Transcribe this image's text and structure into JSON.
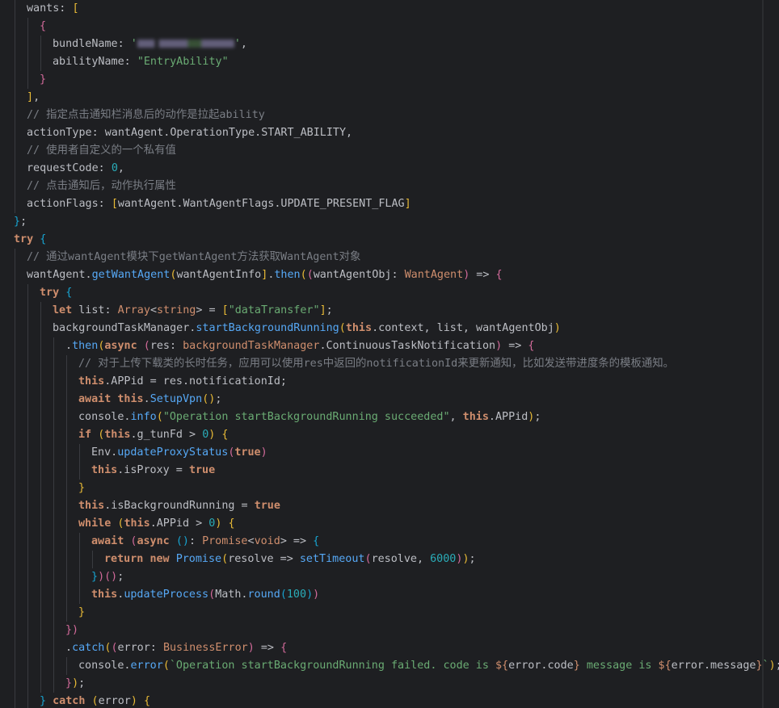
{
  "editor": {
    "language": "ArkTS",
    "colors": {
      "background": "#1e1f22",
      "keyword": "#cf8e6d",
      "string": "#6aab73",
      "number": "#2aacb8",
      "comment": "#7a7e85",
      "function": "#56a8f5",
      "property": "#c77dbb",
      "text": "#bcbec4"
    },
    "redacted_value_note": "",
    "lines": [
      [
        [
          "t-plain",
          "wants: "
        ],
        [
          "t-br",
          "["
        ]
      ],
      [
        [
          "t-br2",
          "{"
        ]
      ],
      [
        [
          "t-plain",
          "bundleName: "
        ],
        [
          "t-str",
          "'"
        ],
        [
          "redacted",
          ""
        ],
        [
          "t-str",
          "'"
        ],
        [
          "t-plain",
          ","
        ]
      ],
      [
        [
          "t-plain",
          "abilityName: "
        ],
        [
          "t-str",
          "\"EntryAbility\""
        ]
      ],
      [
        [
          "t-br2",
          "}"
        ]
      ],
      [
        [
          "t-br",
          "]"
        ],
        [
          "t-plain",
          ","
        ]
      ],
      [
        [
          "t-cm",
          "// 指定点击通知栏消息后的动作是拉起ability"
        ]
      ],
      [
        [
          "t-plain",
          "actionType: wantAgent.OperationType.START_ABILITY,"
        ]
      ],
      [
        [
          "t-cm",
          "// 使用者自定义的一个私有值"
        ]
      ],
      [
        [
          "t-plain",
          "requestCode: "
        ],
        [
          "t-num",
          "0"
        ],
        [
          "t-plain",
          ","
        ]
      ],
      [
        [
          "t-cm",
          "// 点击通知后，动作执行属性"
        ]
      ],
      [
        [
          "t-plain",
          "actionFlags: "
        ],
        [
          "t-br",
          "["
        ],
        [
          "t-plain",
          "wantAgent.WantAgentFlags.UPDATE_PRESENT_FLAG"
        ],
        [
          "t-br",
          "]"
        ]
      ],
      [
        [
          "t-br3",
          "}"
        ],
        [
          "t-plain",
          ";"
        ]
      ],
      [
        [
          "t-kw",
          "try "
        ],
        [
          "t-br3",
          "{"
        ]
      ],
      [
        [
          "t-cm",
          "// 通过wantAgent模块下getWantAgent方法获取WantAgent对象"
        ]
      ],
      [
        [
          "t-plain",
          "wantAgent."
        ],
        [
          "t-fn",
          "getWantAgent"
        ],
        [
          "t-br",
          "("
        ],
        [
          "t-plain",
          "wantAgentInfo"
        ],
        [
          "t-br",
          "]"
        ],
        [
          "t-plain",
          "."
        ],
        [
          "t-fn",
          "then"
        ],
        [
          "t-br",
          "("
        ],
        [
          "t-br2",
          "("
        ],
        [
          "t-plain",
          "wantAgentObj: "
        ],
        [
          "t-type",
          "WantAgent"
        ],
        [
          "t-br2",
          ")"
        ],
        [
          "t-plain",
          " => "
        ],
        [
          "t-br2",
          "{"
        ]
      ],
      [
        [
          "t-kw",
          "try "
        ],
        [
          "t-br3",
          "{"
        ]
      ],
      [
        [
          "t-kw",
          "let "
        ],
        [
          "t-plain",
          "list: "
        ],
        [
          "t-type",
          "Array"
        ],
        [
          "t-plain",
          "<"
        ],
        [
          "t-type",
          "string"
        ],
        [
          "t-plain",
          "> = "
        ],
        [
          "t-br",
          "["
        ],
        [
          "t-str",
          "\"dataTransfer\""
        ],
        [
          "t-br",
          "]"
        ],
        [
          "t-plain",
          ";"
        ]
      ],
      [
        [
          "t-plain",
          "backgroundTaskManager."
        ],
        [
          "t-fn",
          "startBackgroundRunning"
        ],
        [
          "t-br",
          "("
        ],
        [
          "t-kw",
          "this"
        ],
        [
          "t-plain",
          ".context, list, wantAgentObj"
        ],
        [
          "t-br",
          ")"
        ]
      ],
      [
        [
          "t-plain",
          "."
        ],
        [
          "t-fn",
          "then"
        ],
        [
          "t-br",
          "("
        ],
        [
          "t-kw",
          "async "
        ],
        [
          "t-br2",
          "("
        ],
        [
          "t-plain",
          "res: "
        ],
        [
          "t-type",
          "backgroundTaskManager"
        ],
        [
          "t-plain",
          ".ContinuousTaskNotification"
        ],
        [
          "t-br2",
          ")"
        ],
        [
          "t-plain",
          " => "
        ],
        [
          "t-br2",
          "{"
        ]
      ],
      [
        [
          "t-cm",
          "// 对于上传下载类的长时任务，应用可以使用res中返回的notificationId来更新通知，比如发送带进度条的模板通知。"
        ]
      ],
      [
        [
          "t-kw",
          "this"
        ],
        [
          "t-plain",
          ".APPid = res.notificationId;"
        ]
      ],
      [
        [
          "t-kw",
          "await "
        ],
        [
          "t-kw",
          "this"
        ],
        [
          "t-plain",
          "."
        ],
        [
          "t-fn",
          "SetupVpn"
        ],
        [
          "t-br",
          "()"
        ],
        [
          "t-plain",
          ";"
        ]
      ],
      [
        [
          "t-plain",
          "console."
        ],
        [
          "t-fn",
          "info"
        ],
        [
          "t-br",
          "("
        ],
        [
          "t-str",
          "\"Operation startBackgroundRunning succeeded\""
        ],
        [
          "t-plain",
          ", "
        ],
        [
          "t-kw",
          "this"
        ],
        [
          "t-plain",
          ".APPid"
        ],
        [
          "t-br",
          ")"
        ],
        [
          "t-plain",
          ";"
        ]
      ],
      [
        [
          "t-kw",
          "if "
        ],
        [
          "t-br",
          "("
        ],
        [
          "t-kw",
          "this"
        ],
        [
          "t-plain",
          ".g_tunFd > "
        ],
        [
          "t-num",
          "0"
        ],
        [
          "t-br",
          ")"
        ],
        [
          "t-plain",
          " "
        ],
        [
          "t-br",
          "{"
        ]
      ],
      [
        [
          "t-plain",
          "Env."
        ],
        [
          "t-fn",
          "updateProxyStatus"
        ],
        [
          "t-br2",
          "("
        ],
        [
          "t-kw",
          "true"
        ],
        [
          "t-br2",
          ")"
        ]
      ],
      [
        [
          "t-kw",
          "this"
        ],
        [
          "t-plain",
          ".isProxy = "
        ],
        [
          "t-kw",
          "true"
        ]
      ],
      [
        [
          "t-br",
          "}"
        ]
      ],
      [
        [
          "t-kw",
          "this"
        ],
        [
          "t-plain",
          ".isBackgroundRunning = "
        ],
        [
          "t-kw",
          "true"
        ]
      ],
      [
        [
          "t-kw",
          "while "
        ],
        [
          "t-br",
          "("
        ],
        [
          "t-kw",
          "this"
        ],
        [
          "t-plain",
          ".APPid > "
        ],
        [
          "t-num",
          "0"
        ],
        [
          "t-br",
          ")"
        ],
        [
          "t-plain",
          " "
        ],
        [
          "t-br",
          "{"
        ]
      ],
      [
        [
          "t-kw",
          "await "
        ],
        [
          "t-br2",
          "("
        ],
        [
          "t-kw",
          "async "
        ],
        [
          "t-br3",
          "()"
        ],
        [
          "t-plain",
          ": "
        ],
        [
          "t-type",
          "Promise"
        ],
        [
          "t-plain",
          "<"
        ],
        [
          "t-type",
          "void"
        ],
        [
          "t-plain",
          "> => "
        ],
        [
          "t-br3",
          "{"
        ]
      ],
      [
        [
          "t-kw",
          "return "
        ],
        [
          "t-kw",
          "new "
        ],
        [
          "t-fn",
          "Promise"
        ],
        [
          "t-br",
          "("
        ],
        [
          "t-plain",
          "resolve => "
        ],
        [
          "t-fn",
          "setTimeout"
        ],
        [
          "t-br2",
          "("
        ],
        [
          "t-plain",
          "resolve, "
        ],
        [
          "t-num",
          "6000"
        ],
        [
          "t-br2",
          ")"
        ],
        [
          "t-br",
          ")"
        ],
        [
          "t-plain",
          ";"
        ]
      ],
      [
        [
          "t-br3",
          "}"
        ],
        [
          "t-br2",
          ")"
        ],
        [
          "t-br2",
          "()"
        ],
        [
          "t-plain",
          ";"
        ]
      ],
      [
        [
          "t-kw",
          "this"
        ],
        [
          "t-plain",
          "."
        ],
        [
          "t-fn",
          "updateProcess"
        ],
        [
          "t-br2",
          "("
        ],
        [
          "t-plain",
          "Math."
        ],
        [
          "t-fn",
          "round"
        ],
        [
          "t-br3",
          "("
        ],
        [
          "t-num",
          "100"
        ],
        [
          "t-br3",
          ")"
        ],
        [
          "t-br2",
          ")"
        ]
      ],
      [
        [
          "t-br",
          "}"
        ]
      ],
      [
        [
          "t-br2",
          "})"
        ]
      ],
      [
        [
          "t-plain",
          "."
        ],
        [
          "t-fn",
          "catch"
        ],
        [
          "t-br",
          "("
        ],
        [
          "t-br2",
          "("
        ],
        [
          "t-plain",
          "error: "
        ],
        [
          "t-type",
          "BusinessError"
        ],
        [
          "t-br2",
          ")"
        ],
        [
          "t-plain",
          " => "
        ],
        [
          "t-br2",
          "{"
        ]
      ],
      [
        [
          "t-plain",
          "console."
        ],
        [
          "t-fn",
          "error"
        ],
        [
          "t-br",
          "("
        ],
        [
          "t-str",
          "`Operation startBackgroundRunning failed. code is "
        ],
        [
          "t-tpld",
          "${"
        ],
        [
          "t-tplv",
          "error.code"
        ],
        [
          "t-tpld",
          "}"
        ],
        [
          "t-str",
          " message is "
        ],
        [
          "t-tpld",
          "${"
        ],
        [
          "t-tplv",
          "error.message"
        ],
        [
          "t-tpld",
          "}"
        ],
        [
          "t-str",
          "`"
        ],
        [
          "t-br",
          ")"
        ],
        [
          "t-plain",
          ";"
        ]
      ],
      [
        [
          "t-br2",
          "}"
        ],
        [
          "t-br",
          ")"
        ],
        [
          "t-plain",
          ";"
        ]
      ],
      [
        [
          "t-br3",
          "}"
        ],
        [
          "t-plain",
          " "
        ],
        [
          "t-kw",
          "catch "
        ],
        [
          "t-br",
          "("
        ],
        [
          "t-plain",
          "error"
        ],
        [
          "t-br",
          ")"
        ],
        [
          "t-plain",
          " "
        ],
        [
          "t-br",
          "{"
        ]
      ]
    ]
  }
}
